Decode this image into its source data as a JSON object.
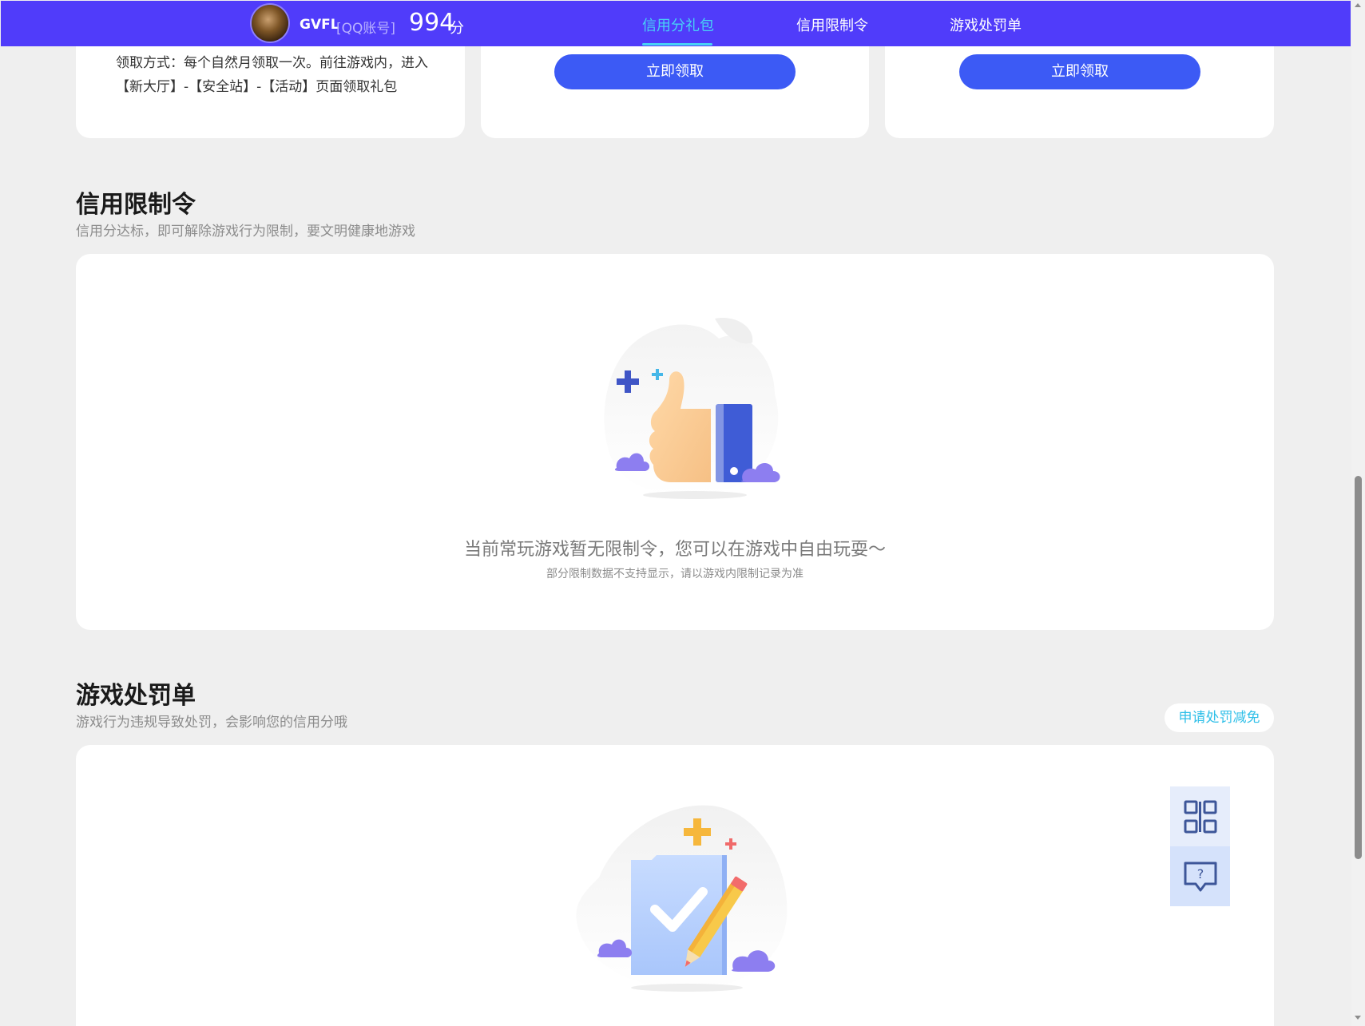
{
  "header": {
    "user_name": "GVFL",
    "account_type": "[QQ账号]",
    "score": "994",
    "score_unit": "分",
    "tabs": [
      {
        "label": "信用分礼包",
        "active": true
      },
      {
        "label": "信用限制令",
        "active": false
      },
      {
        "label": "游戏处罚单",
        "active": false
      }
    ]
  },
  "gift_cards": {
    "description": "领取方式：每个自然月领取一次。前往游戏内，进入【新大厅】-【安全站】-【活动】页面领取礼包",
    "claim_buttons": [
      "立即领取",
      "立即领取"
    ]
  },
  "restriction": {
    "title": "信用限制令",
    "subtitle": "信用分达标，即可解除游戏行为限制，要文明健康地游戏",
    "empty_text": "当前常玩游戏暂无限制令，您可以在游戏中自由玩耍～",
    "empty_note": "部分限制数据不支持显示，请以游戏内限制记录为准",
    "illustration_icon": "thumbs-up-icon"
  },
  "penalty": {
    "title": "游戏处罚单",
    "subtitle": "游戏行为违规导致处罚，会影响您的信用分哦",
    "appeal_button": "申请处罚减免",
    "illustration_icon": "document-check-icon"
  },
  "side_widget": {
    "items": [
      "qr-code-icon",
      "help-chat-icon"
    ]
  },
  "colors": {
    "nav_bg": "#503cfa",
    "nav_active": "#48d2f5",
    "button_primary": "#3c5af5",
    "page_bg": "#efefef"
  }
}
